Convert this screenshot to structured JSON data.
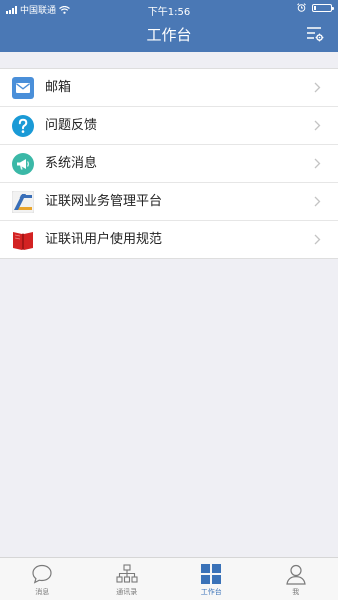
{
  "status_bar": {
    "carrier": "中国联通",
    "time": "下午1:56",
    "battery_level": 0.15
  },
  "header": {
    "title": "工作台",
    "settings_icon": "list-settings-icon"
  },
  "menu": [
    {
      "label": "邮箱",
      "icon": "mail-icon"
    },
    {
      "label": "问题反馈",
      "icon": "question-icon"
    },
    {
      "label": "系统消息",
      "icon": "megaphone-icon"
    },
    {
      "label": "证联网业务管理平台",
      "icon": "platform-logo-icon"
    },
    {
      "label": "证联讯用户使用规范",
      "icon": "book-icon"
    }
  ],
  "tabs": [
    {
      "label": "消息",
      "icon": "chat-bubble-icon",
      "active": false
    },
    {
      "label": "通讯录",
      "icon": "org-chart-icon",
      "active": false
    },
    {
      "label": "工作台",
      "icon": "grid-icon",
      "active": true
    },
    {
      "label": "我",
      "icon": "person-icon",
      "active": false
    }
  ],
  "colors": {
    "header": "#4a78b5",
    "accent": "#3a72b8",
    "background": "#efeff4"
  }
}
